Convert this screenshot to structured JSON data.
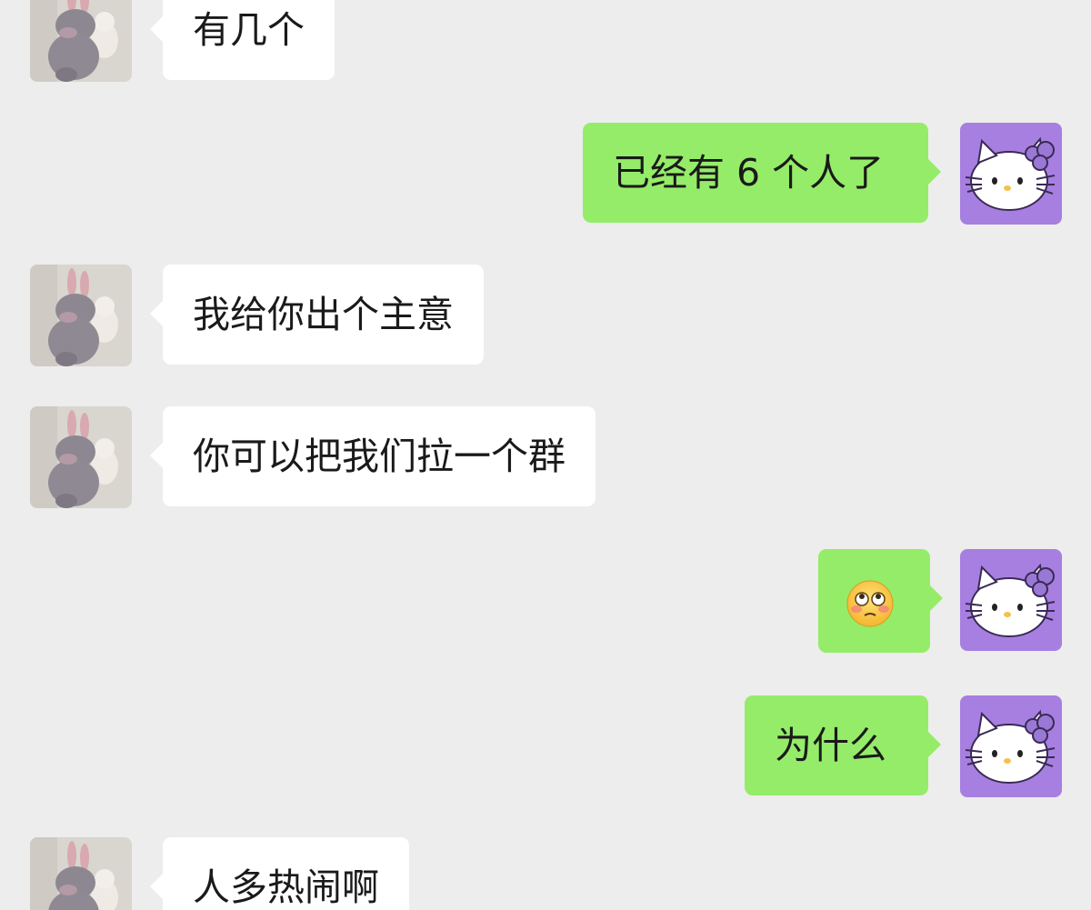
{
  "messages": [
    {
      "side": "in",
      "text": "有几个"
    },
    {
      "side": "out",
      "text": "已经有 6 个人了"
    },
    {
      "side": "in",
      "text": "我给你出个主意"
    },
    {
      "side": "in",
      "text": "你可以把我们拉一个群"
    },
    {
      "side": "out",
      "text": "",
      "emoji": "flushed-face-emoji"
    },
    {
      "side": "out",
      "text": "为什么"
    },
    {
      "side": "in",
      "text": "人多热闹啊"
    }
  ],
  "avatars": {
    "contact": "plush-bunny-avatar",
    "self": "hello-kitty-avatar"
  },
  "colors": {
    "background": "#ededed",
    "incoming_bubble": "#ffffff",
    "outgoing_bubble": "#95ec69",
    "self_avatar_bg": "#a77fe0"
  }
}
